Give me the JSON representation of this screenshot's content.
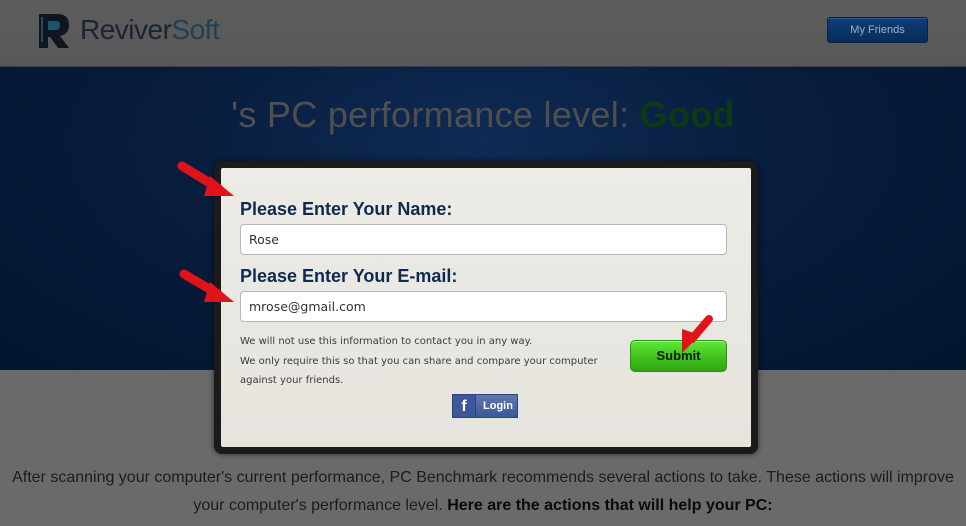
{
  "header": {
    "logo_text_1": "Reviver",
    "logo_text_2": "Soft",
    "my_friends_label": "My Friends"
  },
  "hero": {
    "title_prefix": "'s PC performance level: ",
    "level": "Good"
  },
  "form": {
    "name_label": "Please Enter Your Name:",
    "name_value": "Rose",
    "email_label": "Please Enter Your E-mail:",
    "email_value": "mrose@gmail.com",
    "note_line_1": "We will not use this information to contact you in any way.",
    "note_line_2": "We only require this so that you can share and compare your computer",
    "note_line_3": "against your friends.",
    "submit_label": "Submit",
    "fb_icon": "f",
    "fb_login_label": "Login"
  },
  "description": {
    "line_1": "After scanning your computer's current performance, PC Benchmark recommends several actions to take. These actions will improve",
    "line_2_plain": "your computer's performance level. ",
    "line_2_bold": "Here are the actions that will help your PC:"
  },
  "colors": {
    "hero_blue": "#0d2f63",
    "level_green": "#0d3a13",
    "submit_green": "#3fc21c",
    "annotation_red": "#e0121a",
    "facebook_blue": "#3b5998"
  },
  "icons": {
    "logo": "reviversoft-logo-icon",
    "annotation": "red-arrow-icon",
    "facebook": "facebook-icon"
  }
}
